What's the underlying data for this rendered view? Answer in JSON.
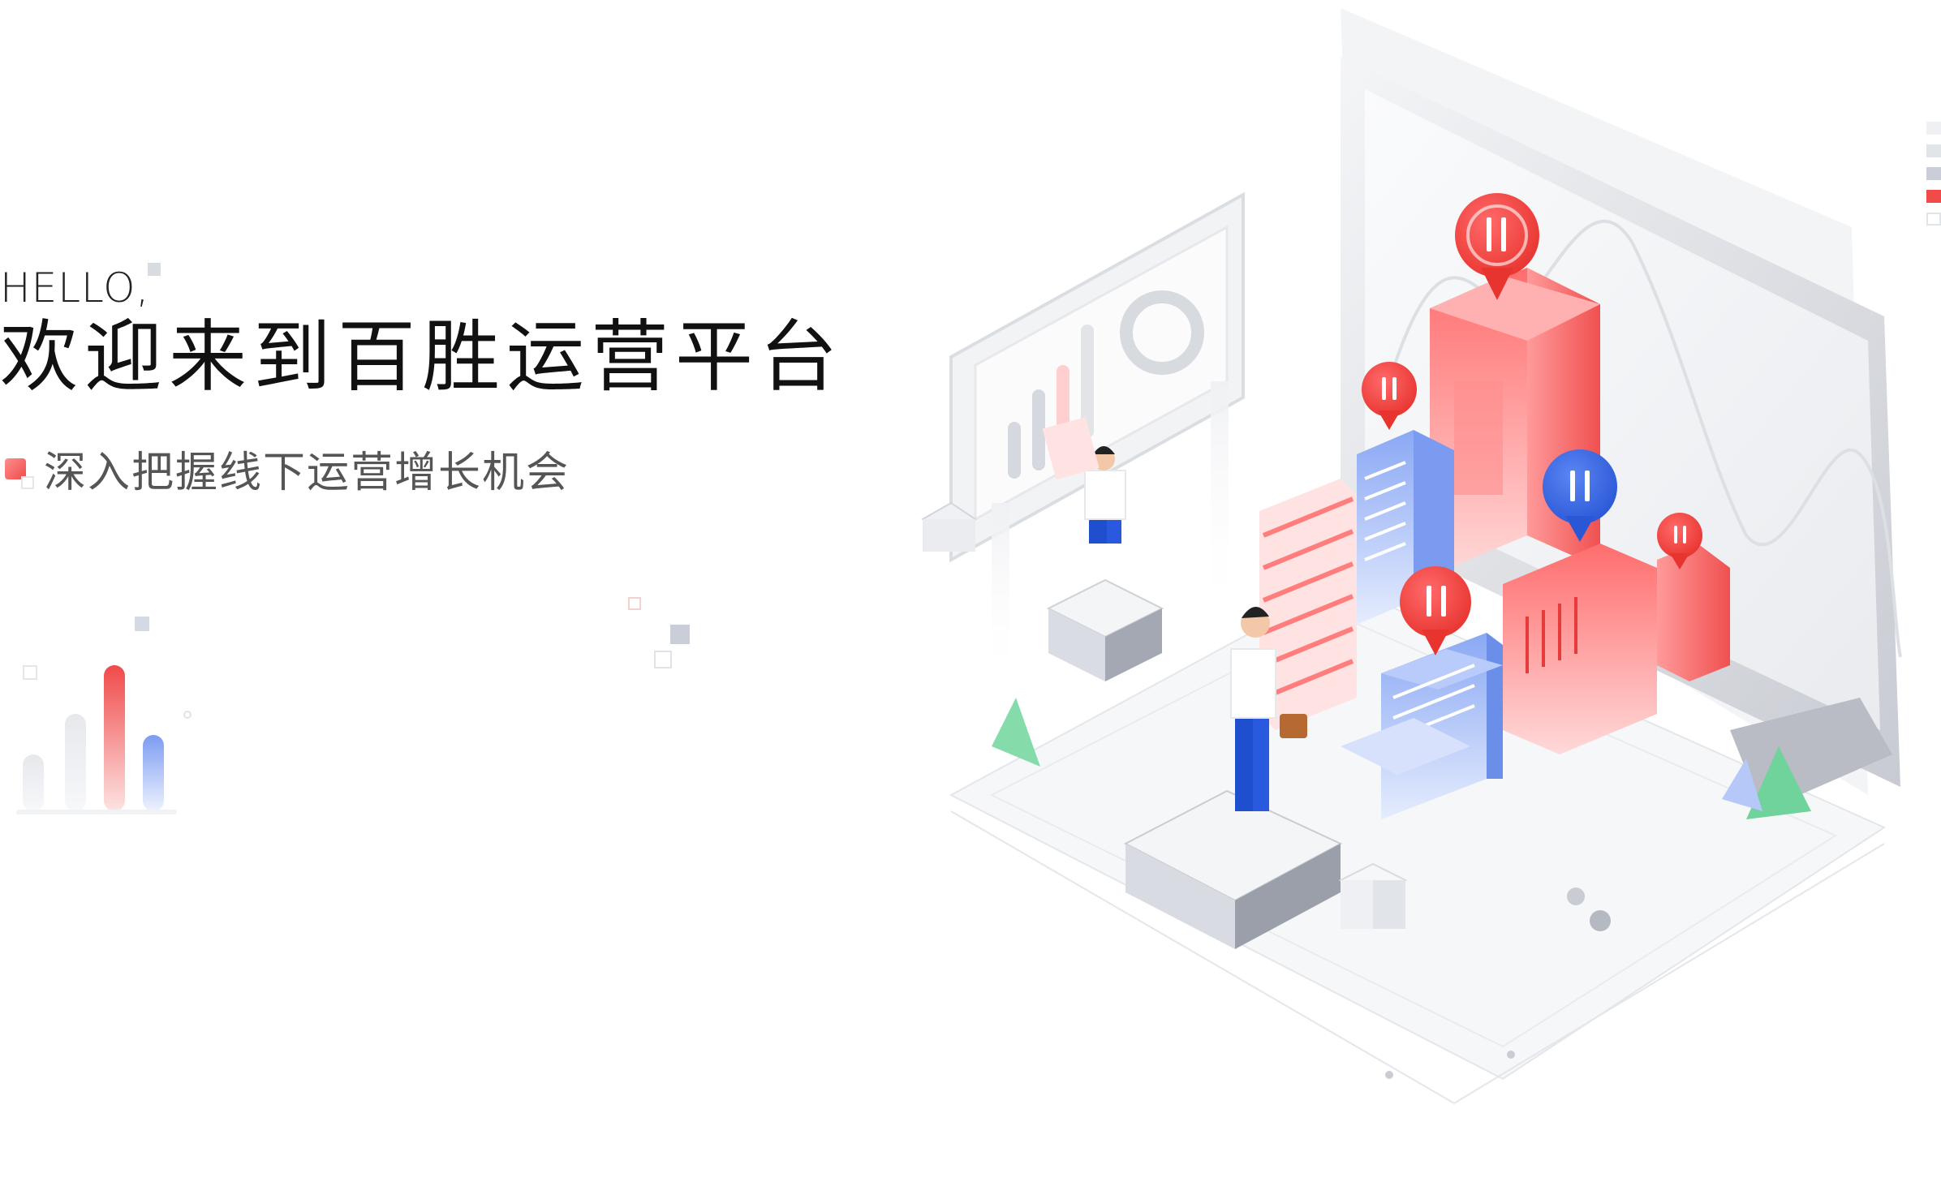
{
  "hero": {
    "greeting": "HELLO,",
    "title": "欢迎来到百胜运营平台",
    "subtitle": "深入把握线下运营增长机会"
  },
  "colors": {
    "accent_red": "#f04a4a",
    "accent_blue": "#3b6be8",
    "accent_green": "#6fd39b",
    "neutral_gray": "#c9ccd3"
  },
  "illustration": {
    "pins": [
      "restaurant-pin-icon",
      "restaurant-pin-icon",
      "restaurant-pin-icon",
      "restaurant-pin-icon",
      "restaurant-pin-icon"
    ],
    "figures": [
      "person-reading-document",
      "person-with-briefcase"
    ]
  }
}
